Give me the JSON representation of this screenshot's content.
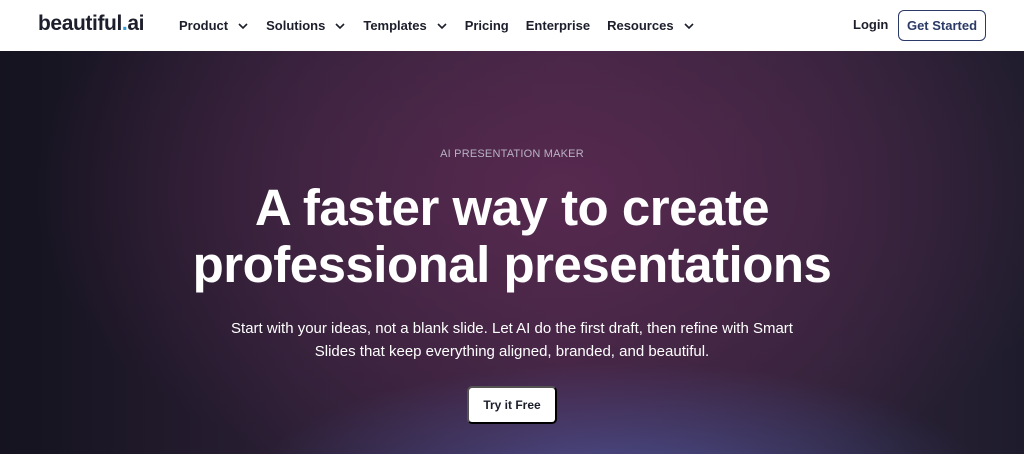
{
  "header": {
    "logo": {
      "text_main": "beautiful",
      "text_dot": ".",
      "text_tld": "ai"
    },
    "nav": [
      {
        "label": "Product",
        "icon": "chevron-down-icon"
      },
      {
        "label": "Solutions",
        "icon": "chevron-down-icon"
      },
      {
        "label": "Templates",
        "icon": "chevron-down-icon"
      },
      {
        "label": "Pricing"
      },
      {
        "label": "Enterprise"
      },
      {
        "label": "Resources",
        "icon": "chevron-down-icon"
      }
    ],
    "login_label": "Login",
    "cta_label": "Get Started"
  },
  "hero": {
    "eyebrow": "AI PRESENTATION MAKER",
    "headline_line1": "A faster way to create",
    "headline_line2": "professional presentations",
    "subtext_line1": "Start with your ideas, not a blank slide. Let AI do the first draft, then refine with Smart",
    "subtext_line2": "Slides that keep everything aligned, branded, and beautiful.",
    "cta_label": "Try it Free"
  },
  "colors": {
    "brand_dark": "#1c1e2b",
    "logo_dot": "#2e9bd6",
    "button_border": "#2b3a66",
    "hero_purple": "#3a2440",
    "hero_glow_blue": "#546cc4"
  }
}
